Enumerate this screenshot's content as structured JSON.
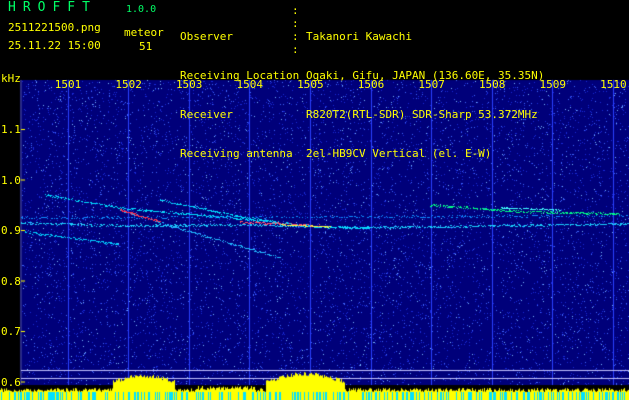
{
  "app": {
    "logo": "HROFFT",
    "version": "1.0.0"
  },
  "file": {
    "name": "2511221500.png",
    "datetime": "25.11.22 15:00"
  },
  "meteor": {
    "label": "meteor",
    "count": "51"
  },
  "info": [
    {
      "key": "Observer",
      "value": "Takanori Kawachi"
    },
    {
      "key": "Receiving Location",
      "value": "Ogaki, Gifu, JAPAN (136.60E, 35.35N)"
    },
    {
      "key": "Receiver",
      "value": "R820T2(RTL-SDR) SDR-Sharp 53.372MHz"
    },
    {
      "key": "Receiving antenna",
      "value": "2el-HB9CV Vertical (el. E-W)"
    }
  ],
  "axes": {
    "x_unit_label": "kHz",
    "minute_ticks": [
      "1501",
      "1502",
      "1503",
      "1504",
      "1505",
      "1506",
      "1507",
      "1508",
      "1509",
      "1510"
    ],
    "y_ticks": [
      "1.1",
      "1.0",
      "0.9",
      "0.8",
      "0.7",
      "0.6"
    ]
  },
  "colors": {
    "background": "#000000",
    "spectrum_base": "#00007a",
    "header_green": "#00ff66",
    "label_yellow": "#ffff00",
    "trace_cyan": "#00e0ff",
    "trace_hot": "#ff3050"
  }
}
